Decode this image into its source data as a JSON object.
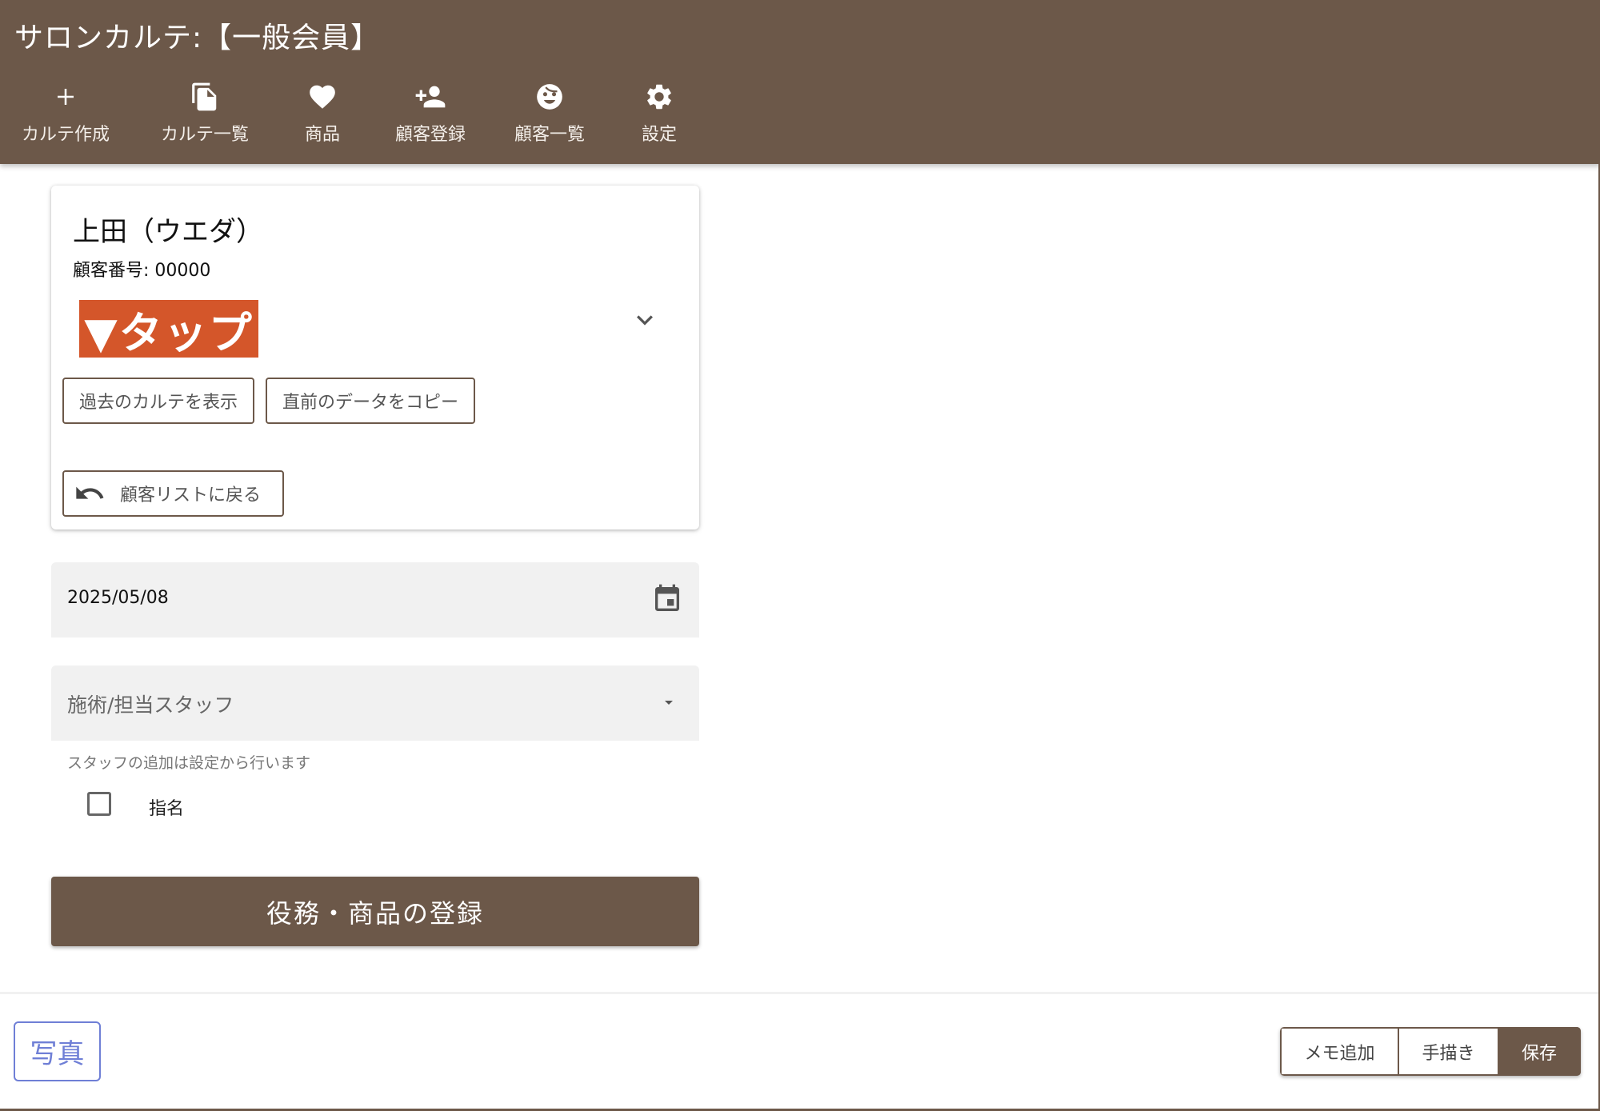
{
  "app": {
    "title": "サロンカルテ:【一般会員】"
  },
  "nav": [
    {
      "label": "カルテ作成",
      "icon": "plus-icon"
    },
    {
      "label": "カルテ一覧",
      "icon": "copy-icon"
    },
    {
      "label": "商品",
      "icon": "heart-icon"
    },
    {
      "label": "顧客登録",
      "icon": "person-add-icon"
    },
    {
      "label": "顧客一覧",
      "icon": "face-icon"
    },
    {
      "label": "設定",
      "icon": "gear-icon"
    }
  ],
  "customer": {
    "name": "上田（ウエダ）",
    "number": "顧客番号: 00000",
    "tap_banner": "▼タップ",
    "show_past_label": "過去のカルテを表示",
    "copy_prev_label": "直前のデータをコピー",
    "back_label": "顧客リストに戻る"
  },
  "form": {
    "date_value": "2025/05/08",
    "staff_placeholder": "施術/担当スタッフ",
    "staff_hint": "スタッフの追加は設定から行います",
    "nomination_label": "指名",
    "register_label": "役務・商品の登録"
  },
  "footer": {
    "photo_label": "写真",
    "memo_label": "メモ追加",
    "handwrite_label": "手描き",
    "save_label": "保存"
  },
  "colors": {
    "brand": "#6c5849",
    "tap": "#d4562a",
    "photo": "#6f7fd6"
  }
}
